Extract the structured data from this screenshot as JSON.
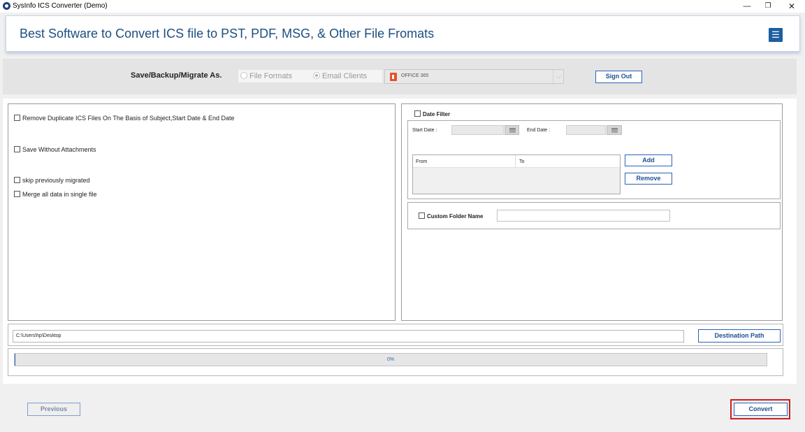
{
  "window": {
    "title": "SysInfo ICS Converter (Demo)",
    "controls": {
      "minimize": "—",
      "maximize": "❐",
      "close": "✕"
    }
  },
  "header": {
    "title": "Best Software to Convert ICS file to PST, PDF, MSG, & Other File Fromats",
    "menu_icon": "☰"
  },
  "save_section": {
    "label": "Save/Backup/Migrate As.",
    "options": [
      {
        "label": "File Formats",
        "selected": false
      },
      {
        "label": "Email Clients",
        "selected": true
      }
    ],
    "client_select_value": "OFFICE 365",
    "client_select_arrow": "⌵",
    "sign_out_label": "Sign Out"
  },
  "options": {
    "remove_duplicates": "Remove Duplicate ICS Files On The Basis of Subject,Start Date & End Date",
    "save_without_attachments": "Save Without Attachments",
    "skip_previously_migrated": "skip previously migrated",
    "merge_all": "Merge all data in single file"
  },
  "date_filter": {
    "label": "Date Filter",
    "start_date_label": "Start Date :",
    "end_date_label": "End Date :",
    "columns": [
      "From",
      "To"
    ],
    "add_label": "Add",
    "remove_label": "Remove"
  },
  "custom_folder": {
    "label": "Custom Folder Name",
    "value": ""
  },
  "destination": {
    "path": "C:\\Users\\hp\\Desktop",
    "button_label": "Destination Path"
  },
  "progress": {
    "percent": 0,
    "text": "0%"
  },
  "footer": {
    "previous_label": "Previous",
    "convert_label": "Convert"
  },
  "colors": {
    "accent": "#2b63b8",
    "header_text": "#1c4f82",
    "highlight": "#cc1f1f"
  }
}
